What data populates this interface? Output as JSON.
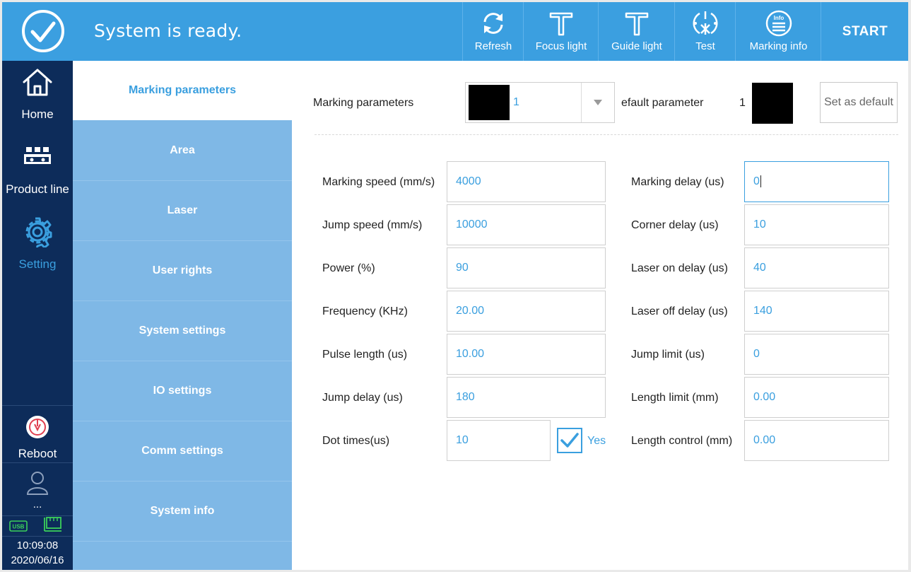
{
  "topbar": {
    "status_icon": "check-circle-icon",
    "status_text": "System is ready.",
    "tools": [
      {
        "label": "Refresh",
        "icon": "refresh-icon"
      },
      {
        "label": "Focus light",
        "icon": "focus-light-icon"
      },
      {
        "label": "Guide light",
        "icon": "guide-light-icon"
      },
      {
        "label": "Test",
        "icon": "test-icon"
      },
      {
        "label": "Marking info",
        "icon": "marking-info-icon"
      }
    ],
    "info_icon_text": "Info",
    "start_label": "START"
  },
  "leftnav": {
    "items": [
      {
        "label": "Home",
        "icon": "home-icon"
      },
      {
        "label": "Product line",
        "icon": "product-line-icon"
      },
      {
        "label": "Setting",
        "icon": "gear-icon"
      }
    ],
    "reboot_label": "Reboot",
    "user_label": "...",
    "usb_text": "USB",
    "time": "10:09:08",
    "date": "2020/06/16"
  },
  "sublist": {
    "items": [
      "Marking parameters",
      "Area",
      "Laser",
      "User rights",
      "System settings",
      "IO settings",
      "Comm settings",
      "System info"
    ],
    "active_index": 0
  },
  "main": {
    "marking_parameters_label": "Marking parameters",
    "selected_parameter": "1",
    "default_parameter_label": "efault parameter",
    "default_parameter_value": "1",
    "set_default_label": "Set as default",
    "left_params": [
      {
        "label": "Marking speed (mm/s)",
        "value": "4000"
      },
      {
        "label": "Jump speed (mm/s)",
        "value": "10000"
      },
      {
        "label": "Power (%)",
        "value": "90"
      },
      {
        "label": "Frequency (KHz)",
        "value": "20.00"
      },
      {
        "label": "Pulse length (us)",
        "value": "10.00"
      },
      {
        "label": "Jump delay (us)",
        "value": "180"
      },
      {
        "label": "Dot times(us)",
        "value": "10"
      }
    ],
    "dot_times_checkbox_label": "Yes",
    "dot_times_checked": true,
    "right_params": [
      {
        "label": "Marking delay (us)",
        "value": "0"
      },
      {
        "label": "Corner delay (us)",
        "value": "10"
      },
      {
        "label": "Laser on delay (us)",
        "value": "40"
      },
      {
        "label": "Laser off delay (us)",
        "value": "140"
      },
      {
        "label": "Jump limit (us)",
        "value": "0"
      },
      {
        "label": "Length limit (mm)",
        "value": "0.00"
      },
      {
        "label": "Length control (mm)",
        "value": "0.00"
      }
    ]
  },
  "colors": {
    "topbar": "#3b9fe0",
    "leftnav": "#0d2c5a",
    "sublist": "#7fb8e6",
    "accent": "#3a9fdf",
    "reboot": "#e04050",
    "status_green": "#3bd05a"
  }
}
